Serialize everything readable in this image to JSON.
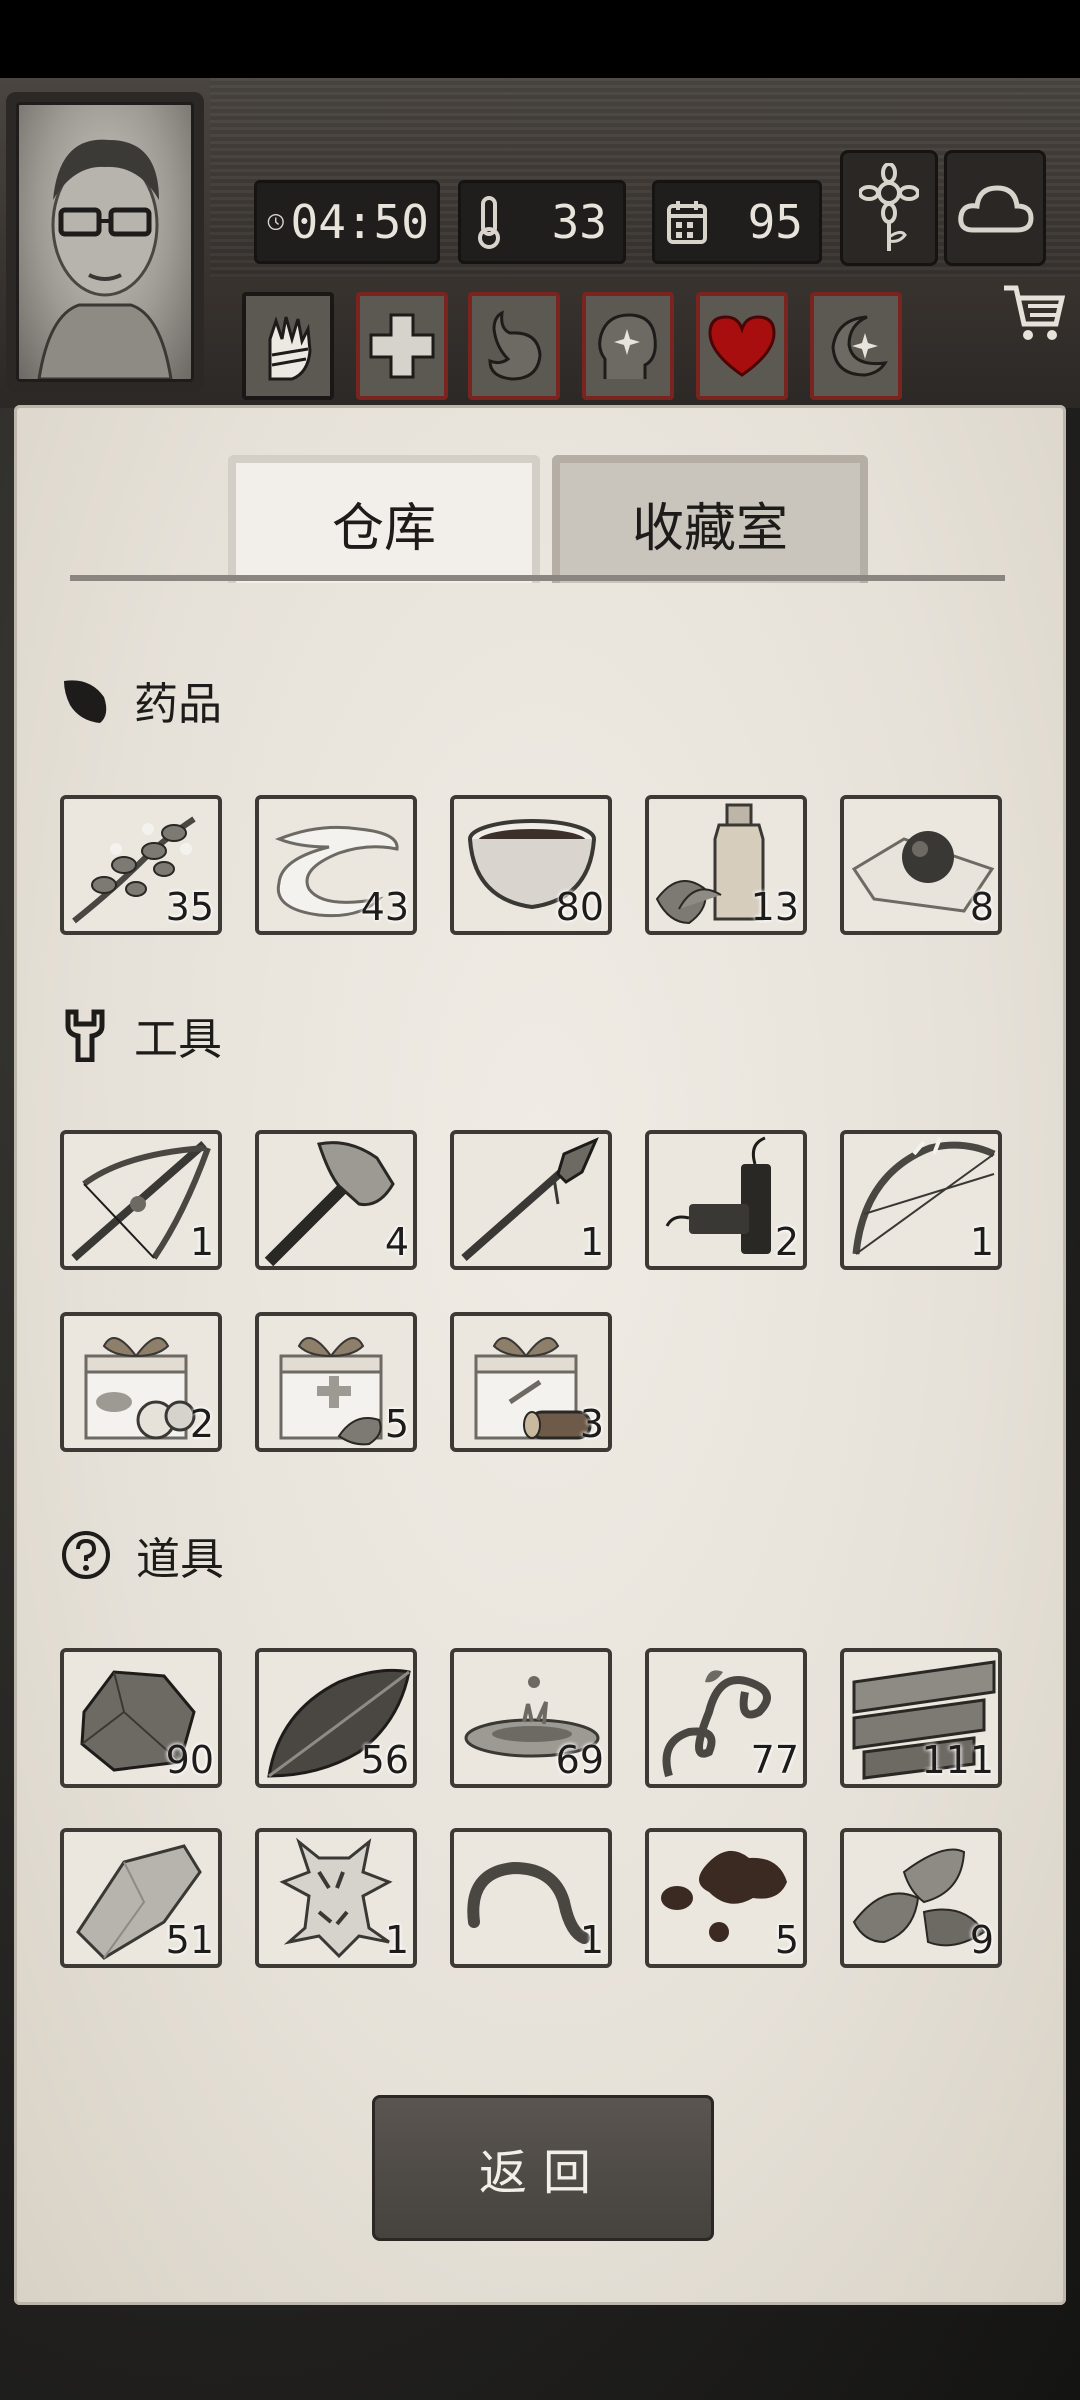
{
  "hud": {
    "time": "04:50",
    "temperature": "33",
    "days": "95"
  },
  "tabs": [
    {
      "label": "仓库",
      "active": true
    },
    {
      "label": "收藏室",
      "active": false
    }
  ],
  "sections": {
    "medicine": {
      "title": "药品",
      "items": [
        {
          "icon": "herb-branch-icon",
          "count": "35"
        },
        {
          "icon": "bandage-icon",
          "count": "43"
        },
        {
          "icon": "soup-bowl-icon",
          "count": "80"
        },
        {
          "icon": "medicine-bottle-icon",
          "count": "13"
        },
        {
          "icon": "pill-on-cloth-icon",
          "count": "8"
        }
      ]
    },
    "tools": {
      "title": "工具",
      "items": [
        {
          "icon": "crossbow-icon",
          "count": "1"
        },
        {
          "icon": "axe-icon",
          "count": "4"
        },
        {
          "icon": "spear-icon",
          "count": "1"
        },
        {
          "icon": "firecracker-icon",
          "count": "2"
        },
        {
          "icon": "bow-icon",
          "count": "1"
        },
        {
          "icon": "food-gift-box-icon",
          "count": "2"
        },
        {
          "icon": "medical-gift-box-icon",
          "count": "5"
        },
        {
          "icon": "material-gift-box-icon",
          "count": "3"
        }
      ]
    },
    "props": {
      "title": "道具",
      "items": [
        {
          "icon": "flint-stone-icon",
          "count": "90"
        },
        {
          "icon": "leaf-icon",
          "count": "56"
        },
        {
          "icon": "water-puddle-icon",
          "count": "69"
        },
        {
          "icon": "vine-icon",
          "count": "77"
        },
        {
          "icon": "wood-planks-icon",
          "count": "111"
        },
        {
          "icon": "stone-icon",
          "count": "51"
        },
        {
          "icon": "animal-hide-icon",
          "count": "1"
        },
        {
          "icon": "worm-icon",
          "count": "1"
        },
        {
          "icon": "resin-blobs-icon",
          "count": "5"
        },
        {
          "icon": "mint-leaves-icon",
          "count": "9"
        }
      ]
    }
  },
  "back_button": "返回",
  "colors": {
    "paper": "#e6e1d8",
    "slot_border": "#3d3a36",
    "heart": "#a80e0e"
  }
}
